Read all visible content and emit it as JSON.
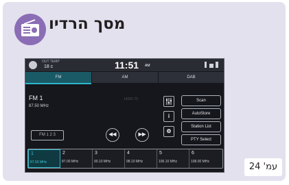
{
  "title": "מסך הרדיו",
  "page_ref": "עמ' 24",
  "status_bar": {
    "outside_temp_label": "OUT TEMP",
    "outside_temp_value": "18 c",
    "time": "11:51",
    "ampm": "AM"
  },
  "tabs": [
    {
      "label": "FM",
      "selected": true
    },
    {
      "label": "AM",
      "selected": false
    },
    {
      "label": "DAB",
      "selected": false
    }
  ],
  "station": {
    "band": "FM 1",
    "frequency": "87.50 MHz",
    "faint_text": "14000   70"
  },
  "buttons": {
    "scan": "Scan",
    "autostore": "AutoStore",
    "station_list": "Station List",
    "pty_select": "PTY Select",
    "band_select": "FM 1 2 3"
  },
  "icons": {
    "eq": "tune-icon",
    "info": "info-icon",
    "settings": "gear-icon",
    "seek_back": "seek-back-icon",
    "seek_forward": "seek-forward-icon",
    "radio": "radio-icon"
  },
  "presets": [
    {
      "number": "1",
      "frequency": "87.50 MHz",
      "active": true
    },
    {
      "number": "2",
      "frequency": "87.00 MHz",
      "active": false
    },
    {
      "number": "3",
      "frequency": "90.10 MHz",
      "active": false
    },
    {
      "number": "4",
      "frequency": "98.10 MHz",
      "active": false
    },
    {
      "number": "5",
      "frequency": "106.10 MHz",
      "active": false
    },
    {
      "number": "6",
      "frequency": "108.00 MHz",
      "active": false
    }
  ],
  "colors": {
    "card_bg": "#e3e1ee",
    "accent_purple": "#8b6db5",
    "active_teal": "#2fb6c8"
  }
}
